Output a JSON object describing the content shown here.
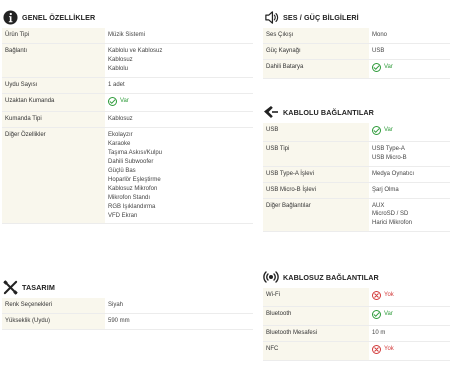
{
  "colors": {
    "yes": "#2e9b3a",
    "no": "#d23a3a",
    "key_bg": "#f9f7ed"
  },
  "general": {
    "title": "GENEL ÖZELLİKLER",
    "icon": "info-icon",
    "rows": [
      {
        "key": "Ürün Tipi",
        "lines": [
          "Müzik Sistemi"
        ]
      },
      {
        "key": "Bağlantı",
        "lines": [
          "Kablolu ve Kablosuz",
          "Kablosuz",
          "Kablolu"
        ]
      },
      {
        "key": "Uydu Sayısı",
        "lines": [
          "1 adet"
        ]
      },
      {
        "key": "Uzaktan Kumanda",
        "status": "yes",
        "value": "Var"
      },
      {
        "key": "Kumanda Tipi",
        "lines": [
          "Kablosuz"
        ]
      },
      {
        "key": "Diğer Özellikler",
        "lines": [
          "Ekolayzır",
          "Karaoke",
          "Taşıma Askısı/Kulpu",
          "Dahili Subwoofer",
          "Güçlü Bas",
          "Hoparlör Eşleştirme",
          "Kablosuz Mikrofon",
          "Mikrofon Standı",
          "RGB Işıklandırma",
          "VFD Ekran"
        ]
      }
    ]
  },
  "design": {
    "title": "TASARIM",
    "icon": "crossed-tools-icon",
    "rows": [
      {
        "key": "Renk Seçenekleri",
        "lines": [
          "Siyah"
        ]
      },
      {
        "key": "Yükseklik (Uydu)",
        "lines": [
          "590 mm"
        ]
      }
    ]
  },
  "sound": {
    "title": "SES / GÜÇ BİLGİLERİ",
    "icon": "speaker-icon",
    "rows": [
      {
        "key": "Ses Çıkışı",
        "lines": [
          "Mono"
        ]
      },
      {
        "key": "Güç Kaynağı",
        "lines": [
          "USB"
        ]
      },
      {
        "key": "Dahili Batarya",
        "status": "yes",
        "value": "Var"
      }
    ]
  },
  "wired": {
    "title": "KABLOLU BAĞLANTILAR",
    "icon": "connector-icon",
    "rows": [
      {
        "key": "USB",
        "status": "yes",
        "value": "Var"
      },
      {
        "key": "USB Tipi",
        "lines": [
          "USB Type-A",
          "USB Micro-B"
        ]
      },
      {
        "key": "USB Type-A İşlevi",
        "lines": [
          "Medya Oynatıcı"
        ]
      },
      {
        "key": "USB Micro-B İşlevi",
        "lines": [
          "Şarj Olma"
        ]
      },
      {
        "key": "Diğer Bağlantılar",
        "lines": [
          "AUX",
          "MicroSD / SD",
          "Harici Mikrofon"
        ]
      }
    ]
  },
  "wireless": {
    "title": "KABLOSUZ BAĞLANTILAR",
    "icon": "wireless-broadcast-icon",
    "rows": [
      {
        "key": "Wi-Fi",
        "status": "no",
        "value": "Yok"
      },
      {
        "key": "Bluetooth",
        "status": "yes",
        "value": "Var"
      },
      {
        "key": "Bluetooth Mesafesi",
        "lines": [
          "10 m"
        ]
      },
      {
        "key": "NFC",
        "status": "no",
        "value": "Yok"
      }
    ]
  }
}
